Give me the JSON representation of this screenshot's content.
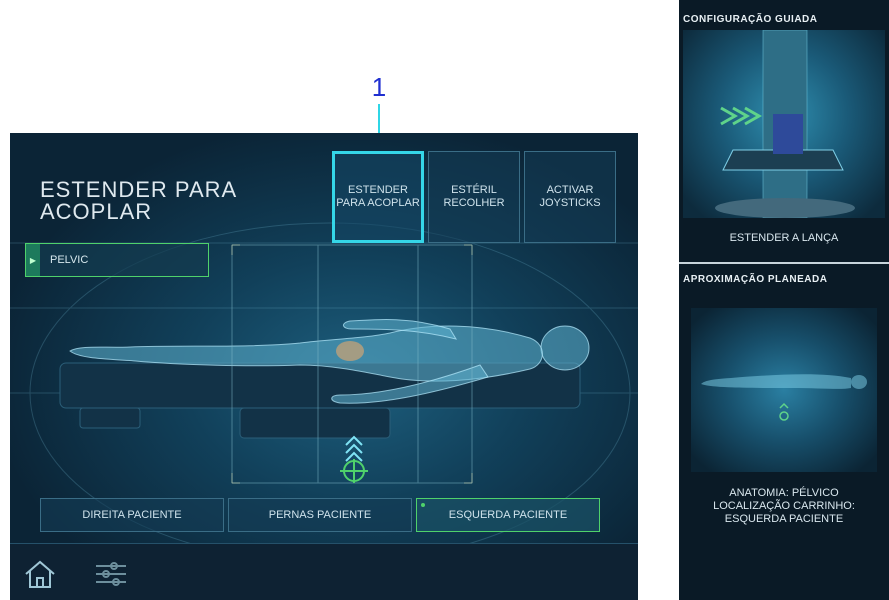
{
  "callout": {
    "number": "1"
  },
  "screen": {
    "title_line1": "ESTENDER PARA",
    "title_line2": "ACOPLAR",
    "top_buttons": [
      {
        "label": "ESTENDER\nPARA ACOPLAR",
        "active": true
      },
      {
        "label": "ESTÉRIL\nRECOLHER",
        "active": false
      },
      {
        "label": "ACTIVAR\nJOYSTICKS",
        "active": false
      }
    ],
    "anatomy_selector": {
      "label": "PELVIC"
    },
    "bottom_buttons": [
      {
        "label": "DIREITA PACIENTE",
        "active": false
      },
      {
        "label": "PERNAS PACIENTE",
        "active": false
      },
      {
        "label": "ESQUERDA PACIENTE",
        "active": true
      }
    ],
    "footer": {
      "home_icon": "home-icon",
      "settings_icon": "sliders-icon"
    }
  },
  "side_panel": {
    "section1_title": "CONFIGURAÇÃO GUIADA",
    "section1_caption": "ESTENDER A LANÇA",
    "section2_title": "APROXIMAÇÃO PLANEADA",
    "section2_caption": "ANATOMIA: PÉLVICO\nLOCALIZAÇÃO CARRINHO:\nESQUERDA PACIENTE"
  },
  "colors": {
    "accent": "#35d6e8",
    "active_green": "#4fd26b",
    "callout_blue": "#1f2fd0"
  }
}
